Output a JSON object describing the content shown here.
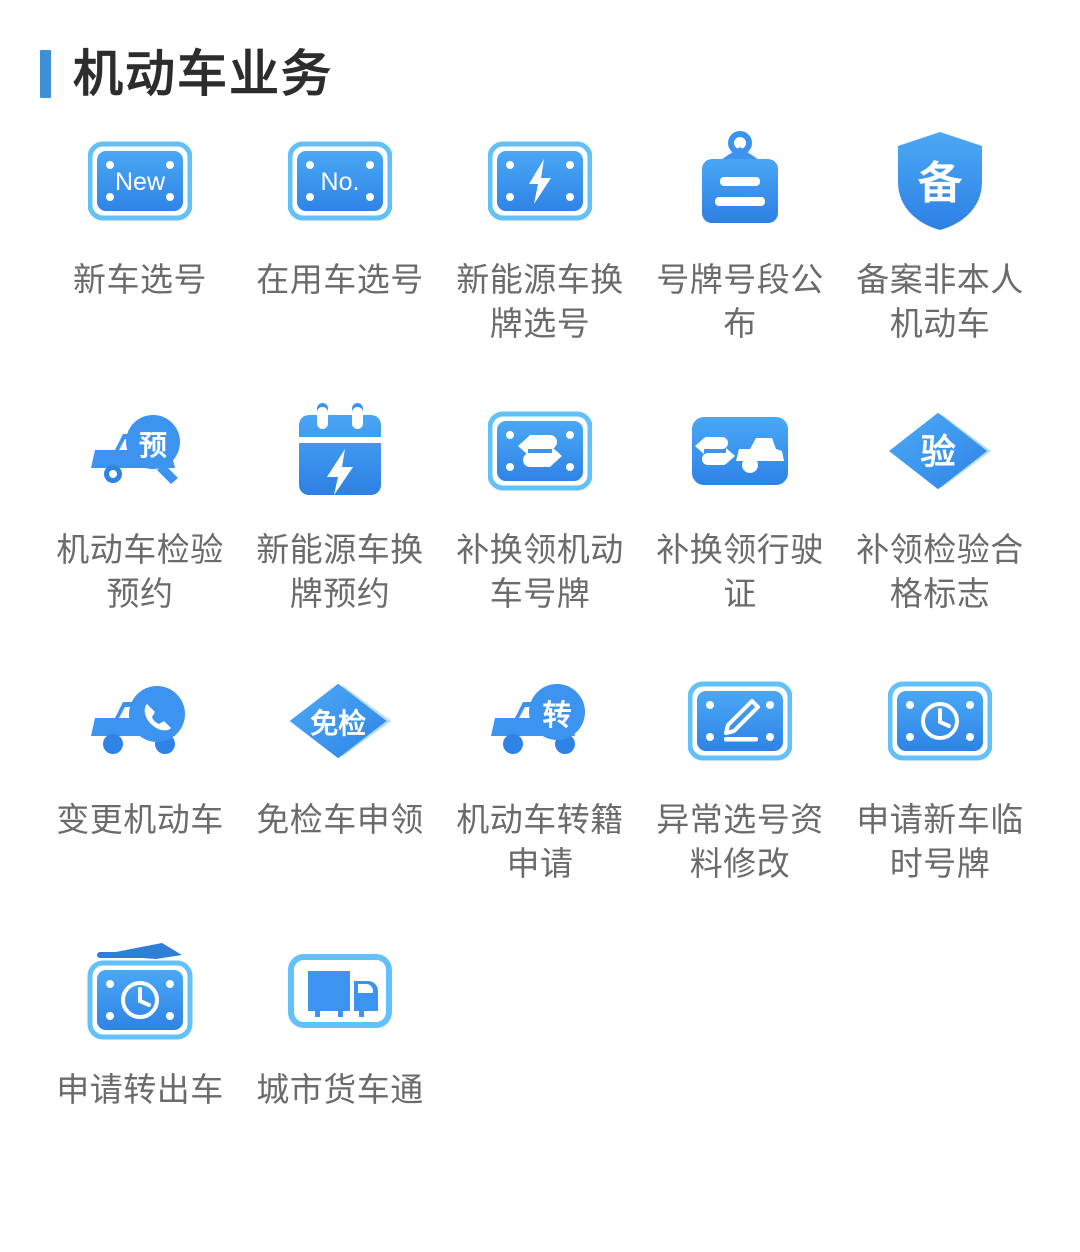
{
  "header": {
    "title": "机动车业务",
    "accent_color": "#3d8fd6"
  },
  "theme": {
    "icon_blue_light": "#5bb9f5",
    "icon_blue": "#3d93f0",
    "icon_blue_dark": "#2f7fe0",
    "label_color": "#6b6b6b",
    "background": "#ffffff"
  },
  "grid": {
    "columns": 5,
    "items": [
      {
        "label": "新车选号",
        "icon": "plate-new-icon",
        "glyph": "New"
      },
      {
        "label": "在用车选号",
        "icon": "plate-no-icon",
        "glyph": "No."
      },
      {
        "label": "新能源车换牌选号",
        "icon": "plate-lightning-icon",
        "glyph": ""
      },
      {
        "label": "号牌号段公布",
        "icon": "hanging-signboard-icon",
        "glyph": ""
      },
      {
        "label": "备案非本人机动车",
        "icon": "shield-bei-icon",
        "glyph": "备"
      },
      {
        "label": "机动车检验预约",
        "icon": "car-magnifier-yu-icon",
        "glyph": "预"
      },
      {
        "label": "新能源车换牌预约",
        "icon": "calendar-lightning-icon",
        "glyph": ""
      },
      {
        "label": "补换领机动车号牌",
        "icon": "plate-swap-icon",
        "glyph": ""
      },
      {
        "label": "补换领行驶证",
        "icon": "car-swap-icon",
        "glyph": ""
      },
      {
        "label": "补领检验合格标志",
        "icon": "diamond-yan-icon",
        "glyph": "验"
      },
      {
        "label": "变更机动车",
        "icon": "car-phone-icon",
        "glyph": ""
      },
      {
        "label": "免检车申领",
        "icon": "diamond-mianjian-icon",
        "glyph": "免检"
      },
      {
        "label": "机动车转籍申请",
        "icon": "car-zhuan-icon",
        "glyph": "转"
      },
      {
        "label": "异常选号资料修改",
        "icon": "plate-edit-icon",
        "glyph": ""
      },
      {
        "label": "申请新车临时号牌",
        "icon": "plate-clock-icon",
        "glyph": ""
      },
      {
        "label": "申请转出车",
        "icon": "plate-clock-arrow-icon",
        "glyph": ""
      },
      {
        "label": "城市货车通",
        "icon": "truck-frame-icon",
        "glyph": ""
      }
    ]
  }
}
